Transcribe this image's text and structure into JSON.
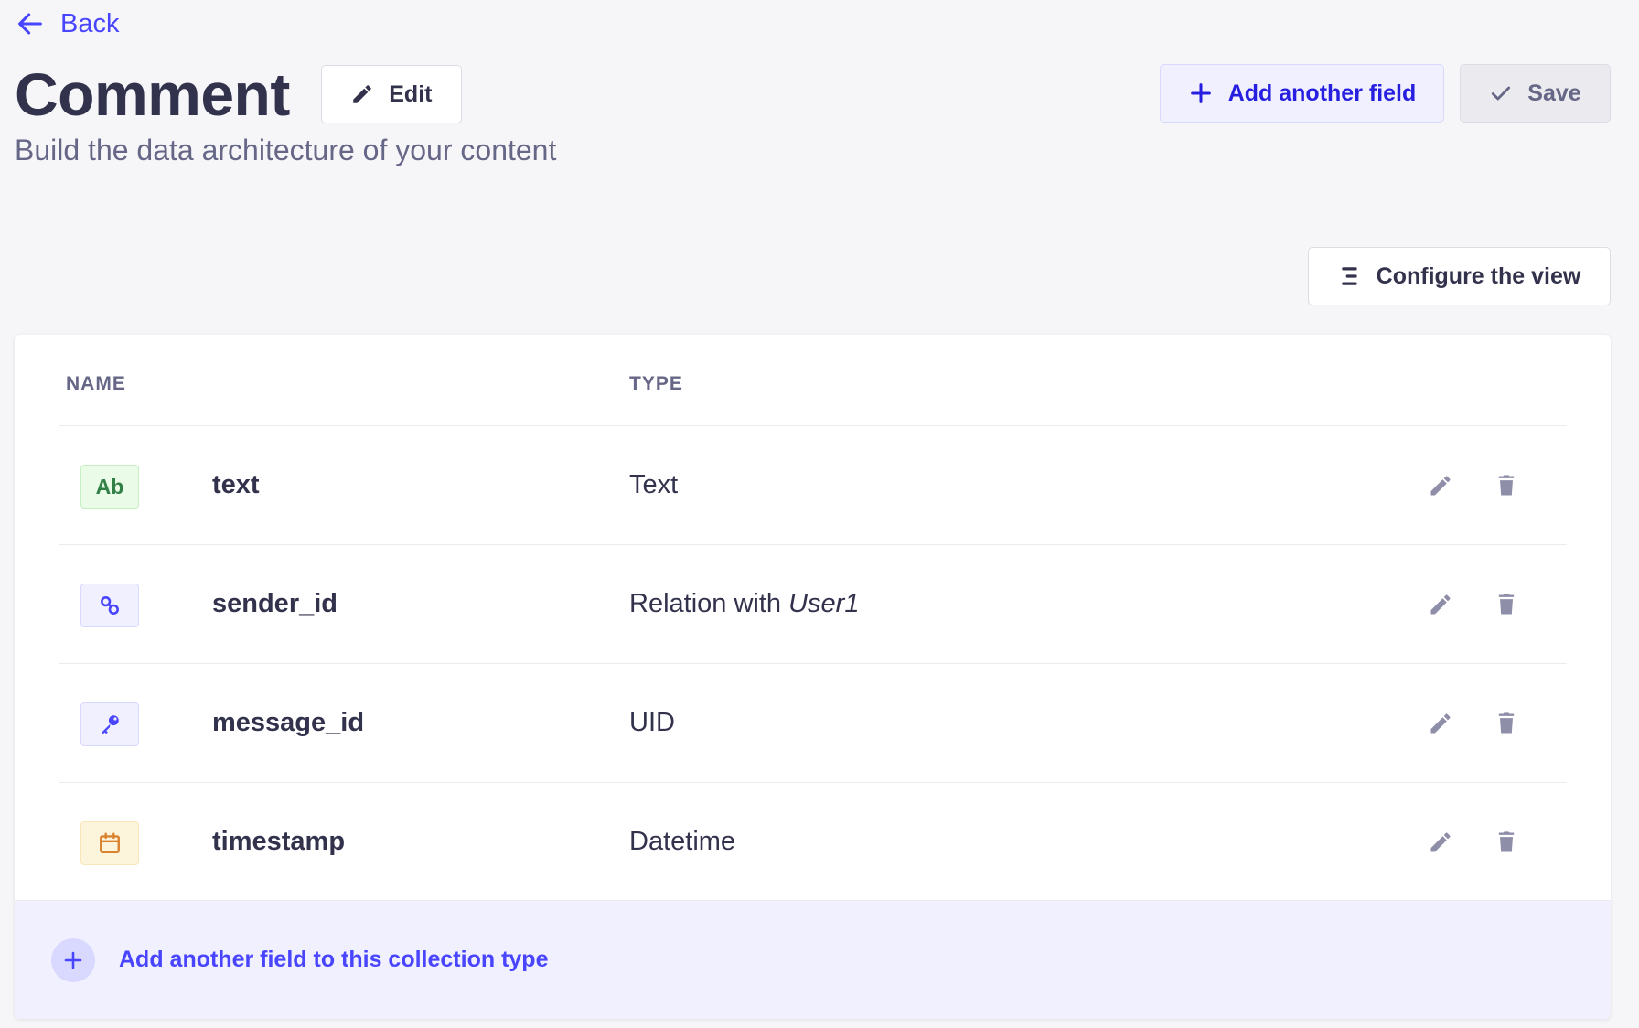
{
  "nav": {
    "back_label": "Back"
  },
  "header": {
    "title": "Comment",
    "edit_label": "Edit",
    "subtitle": "Build the data architecture of your content",
    "add_field_label": "Add another field",
    "save_label": "Save"
  },
  "toolbar": {
    "configure_label": "Configure the view"
  },
  "table": {
    "columns": [
      "NAME",
      "TYPE"
    ],
    "rows": [
      {
        "icon": "text-type-icon",
        "icon_text": "Ab",
        "name": "text",
        "type": "Text",
        "type_target": ""
      },
      {
        "icon": "relation-link-icon",
        "name": "sender_id",
        "type": "Relation with ",
        "type_target": "User1"
      },
      {
        "icon": "uid-key-icon",
        "name": "message_id",
        "type": "UID",
        "type_target": ""
      },
      {
        "icon": "calendar-icon",
        "name": "timestamp",
        "type": "Datetime",
        "type_target": ""
      }
    ]
  },
  "footer": {
    "add_field_label": "Add another field to this collection type"
  },
  "colors": {
    "accent": "#4945ff",
    "background": "#f6f6f9",
    "text": "#32324d",
    "muted": "#666687",
    "text_type": "#328048",
    "date_type": "#d9822f"
  }
}
